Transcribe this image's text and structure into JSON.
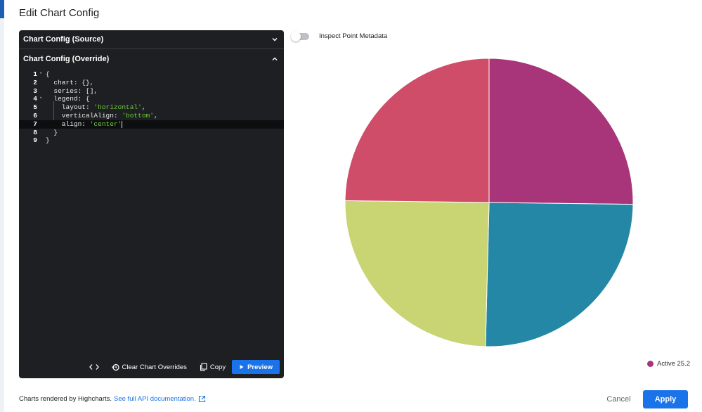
{
  "dialog": {
    "title": "Edit Chart Config"
  },
  "source_panel": {
    "title": "Chart Config (Source)"
  },
  "override_panel": {
    "title": "Chart Config (Override)",
    "code_lines": [
      {
        "num": "1",
        "fold": true,
        "text": "{"
      },
      {
        "num": "2",
        "fold": false,
        "text": "  chart: {},"
      },
      {
        "num": "3",
        "fold": false,
        "text": "  series: [],"
      },
      {
        "num": "4",
        "fold": true,
        "text": "  legend: {"
      },
      {
        "num": "5",
        "fold": false,
        "text": "    layout: ",
        "string": "'horizontal'",
        "suffix": ","
      },
      {
        "num": "6",
        "fold": false,
        "text": "    verticalAlign: ",
        "string": "'bottom'",
        "suffix": ","
      },
      {
        "num": "7",
        "fold": false,
        "text": "    align: ",
        "string": "'center'",
        "suffix": "",
        "active": true
      },
      {
        "num": "8",
        "fold": false,
        "text": "  }"
      },
      {
        "num": "9",
        "fold": false,
        "text": "}"
      }
    ]
  },
  "toolbar": {
    "code_icon": "code-brackets-icon",
    "clear_label": "Clear Chart Overrides",
    "copy_label": "Copy",
    "preview_label": "Preview"
  },
  "inspect": {
    "label": "Inspect Point Metadata",
    "enabled": false
  },
  "chart_data": {
    "type": "pie",
    "slices": [
      {
        "name": "Active 25.2",
        "value": 25.2,
        "color": "#a8357a"
      },
      {
        "value": 25.2,
        "color": "#2487a5"
      },
      {
        "value": 24.8,
        "color": "#c9d473"
      },
      {
        "value": 24.8,
        "color": "#cf4d69"
      }
    ],
    "legend": {
      "label": "Active 25.2",
      "color": "#a8357a",
      "position": "bottom-right"
    }
  },
  "footer": {
    "text": "Charts rendered by Highcharts.",
    "link": "See full API documentation.",
    "cancel_label": "Cancel",
    "apply_label": "Apply"
  },
  "colors": {
    "accent": "#1a73e8",
    "editor_bg": "#1e1f22",
    "string": "#6ccb3a"
  }
}
